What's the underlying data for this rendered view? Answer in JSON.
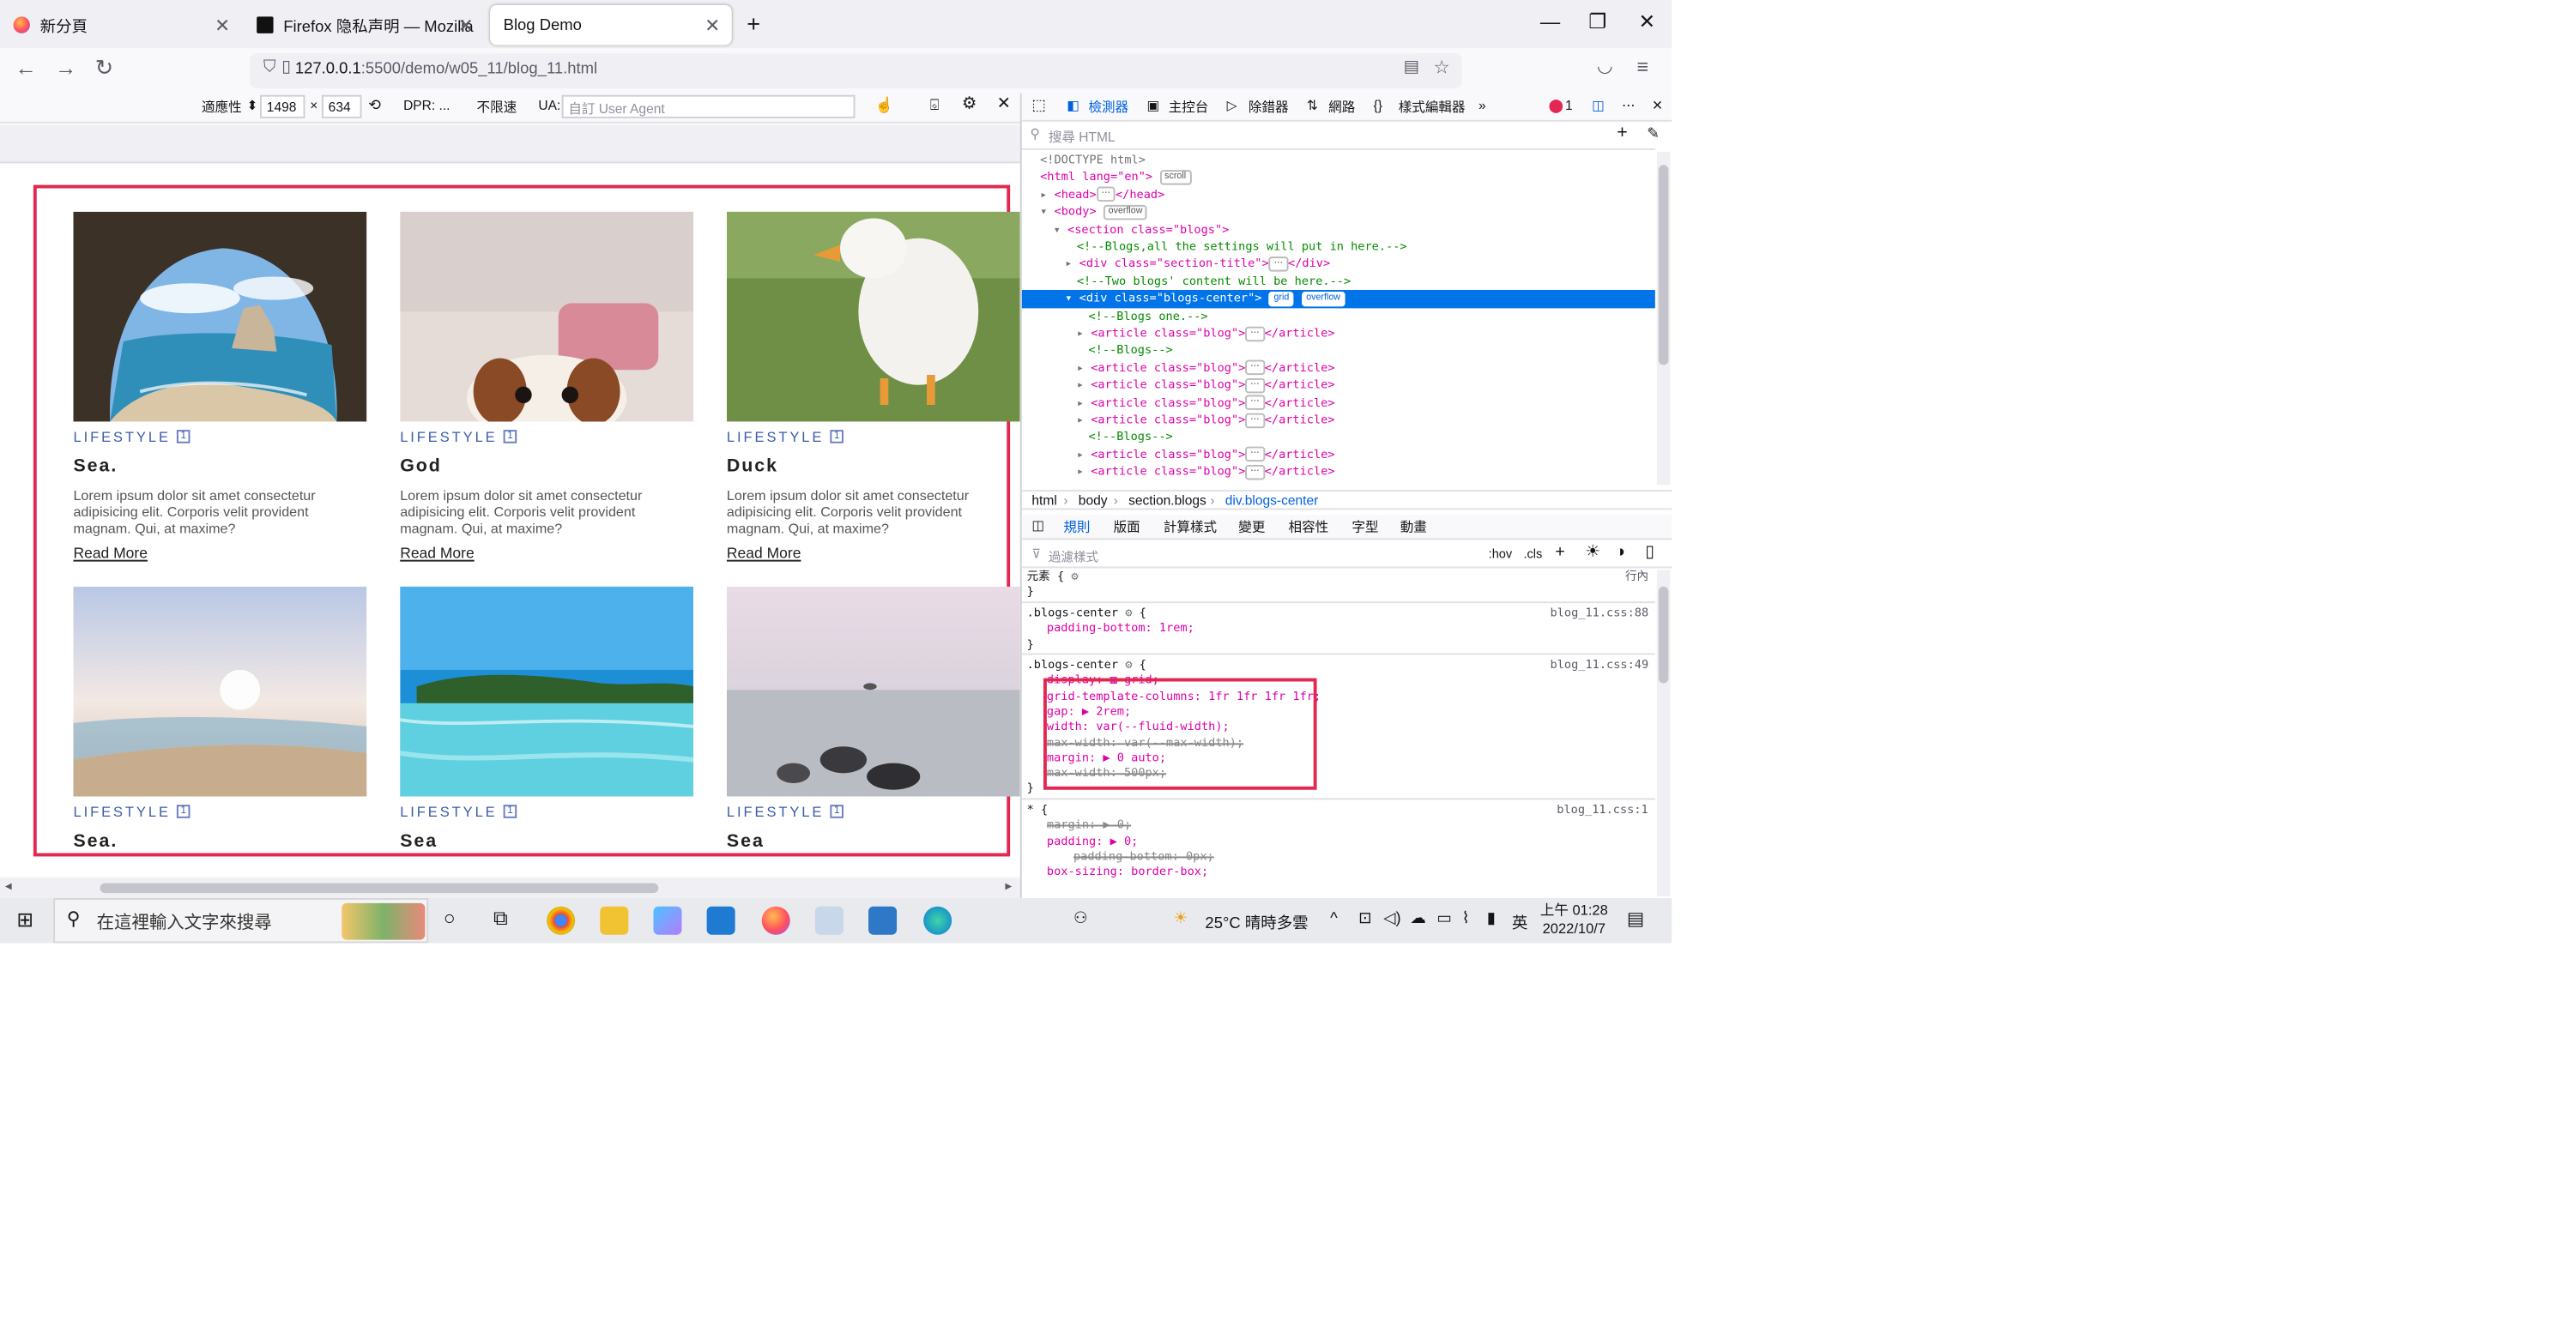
{
  "browser": {
    "tabs": [
      {
        "title": "新分頁"
      },
      {
        "title": "Firefox 隐私声明 — Mozilla"
      },
      {
        "title": "Blog Demo"
      }
    ],
    "url_host": "127.0.0.1",
    "url_path": ":5500/demo/w05_11/blog_11.html",
    "accent": "#0061e0"
  },
  "rdm": {
    "device": "適應性",
    "width": "1498",
    "times": "×",
    "height": "634",
    "dpr": "DPR: ...",
    "throttle": "不限速",
    "ua_label": "UA:",
    "ua_placeholder": "自訂 User Agent"
  },
  "blogs": [
    {
      "category": "LIFESTYLE",
      "badge": "1",
      "title": "Sea.",
      "text": "Lorem ipsum dolor sit amet consectetur adipisicing elit. Corporis velit provident magnam. Qui, at maxime?",
      "link": "Read More",
      "image": "sea-cave"
    },
    {
      "category": "LIFESTYLE",
      "badge": "1",
      "title": "God",
      "text": "Lorem ipsum dolor sit amet consectetur adipisicing elit. Corporis velit provident magnam. Qui, at maxime?",
      "link": "Read More",
      "image": "dog"
    },
    {
      "category": "LIFESTYLE",
      "badge": "1",
      "title": "Duck",
      "text": "Lorem ipsum dolor sit amet consectetur adipisicing elit. Corporis velit provident magnam. Qui, at maxime?",
      "link": "Read More",
      "image": "duck"
    },
    {
      "category": "LIFESTYLE",
      "badge": "1",
      "title": "Sea.",
      "image": "beach-sunset"
    },
    {
      "category": "LIFESTYLE",
      "badge": "1",
      "title": "Sea",
      "image": "tropical-sea"
    },
    {
      "category": "LIFESTYLE",
      "badge": "1",
      "title": "Sea",
      "image": "rocky-shore"
    }
  ],
  "devtools": {
    "tabs": [
      "檢測器",
      "主控台",
      "除錯器",
      "網路",
      "樣式編輯器"
    ],
    "error_count": "1",
    "search_placeholder": "搜尋 HTML",
    "markup": [
      "<!DOCTYPE html>",
      "<html lang=\"en\">",
      "scroll",
      "<head>",
      "</head>",
      "<body>",
      "overflow",
      "<section class=\"blogs\">",
      "<!--Blogs,all the settings will put in here.-->",
      "<div class=\"section-title\">",
      "</div>",
      "<!--Two blogs' content will be here.-->",
      "<div class=\"blogs-center\">",
      "grid",
      "<!--Blogs one.-->",
      "<article class=\"blog\">",
      "</article>",
      "<!--Blogs-->"
    ],
    "breadcrumb": [
      "html",
      "body",
      "section.blogs",
      "div.blogs-center"
    ],
    "rules_tabs": [
      "規則",
      "版面",
      "計算樣式",
      "變更",
      "相容性",
      "字型",
      "動畫"
    ],
    "filter_placeholder": "過濾樣式",
    "hov": ":hov",
    "cls": ".cls",
    "element_label": "元素 {",
    "inline_label": "行內",
    "rule1_selector": ".blogs-center",
    "rule1_src": "blog_11.css:88",
    "rule1_props": [
      "padding-bottom: 1rem;"
    ],
    "rule2_selector": ".blogs-center",
    "rule2_src": "blog_11.css:49",
    "rule2_props": [
      "display: ▦ grid;",
      "grid-template-columns: 1fr 1fr 1fr 1fr;",
      "gap: ▶ 2rem;",
      "width: var(--fluid-width);",
      "max-width: var(--max-width);",
      "margin: ▶ 0 auto;",
      "max-width: 500px;"
    ],
    "rule3_selector": "* {",
    "rule3_src": "blog_11.css:1",
    "rule3_props": [
      "margin: ▶ 0;",
      "padding: ▶ 0;",
      "padding-bottom: 0px;",
      "box-sizing: border-box;"
    ]
  },
  "taskbar": {
    "search_placeholder": "在這裡輸入文字來搜尋",
    "weather": "25°C  晴時多雲",
    "ime": "英",
    "time": "上午 01:28",
    "date": "2022/10/7"
  }
}
